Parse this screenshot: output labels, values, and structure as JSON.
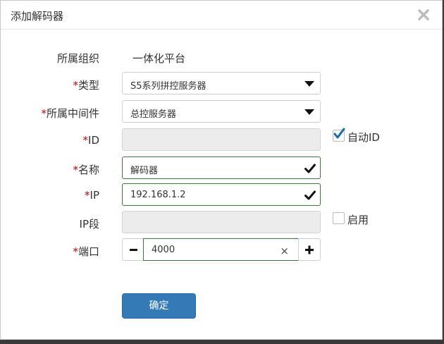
{
  "dialog": {
    "title": "添加解码器",
    "close_icon": "close-icon"
  },
  "form": {
    "org": {
      "label": "所属组织",
      "value": "一体化平台"
    },
    "type": {
      "required": "*",
      "label": "类型",
      "value": "S5系列拼控服务器"
    },
    "middleware": {
      "required": "*",
      "label": "所属中间件",
      "value": "总控服务器"
    },
    "id": {
      "required": "*",
      "label": "ID",
      "value": "",
      "auto_label": "自动ID",
      "auto_checked": true
    },
    "name": {
      "required": "*",
      "label": "名称",
      "value": "解码器"
    },
    "ip": {
      "required": "*",
      "label": "IP",
      "value": "192.168.1.2"
    },
    "ip_range": {
      "label": "IP段",
      "value": "",
      "enable_label": "启用",
      "enable_checked": false
    },
    "port": {
      "required": "*",
      "label": "端口",
      "value": "4000",
      "clear": "×"
    }
  },
  "actions": {
    "confirm_label": "确定"
  },
  "colors": {
    "primary": "#337ab7",
    "required": "#c40000",
    "valid": "#3c763d",
    "check": "#1a6aa8"
  }
}
